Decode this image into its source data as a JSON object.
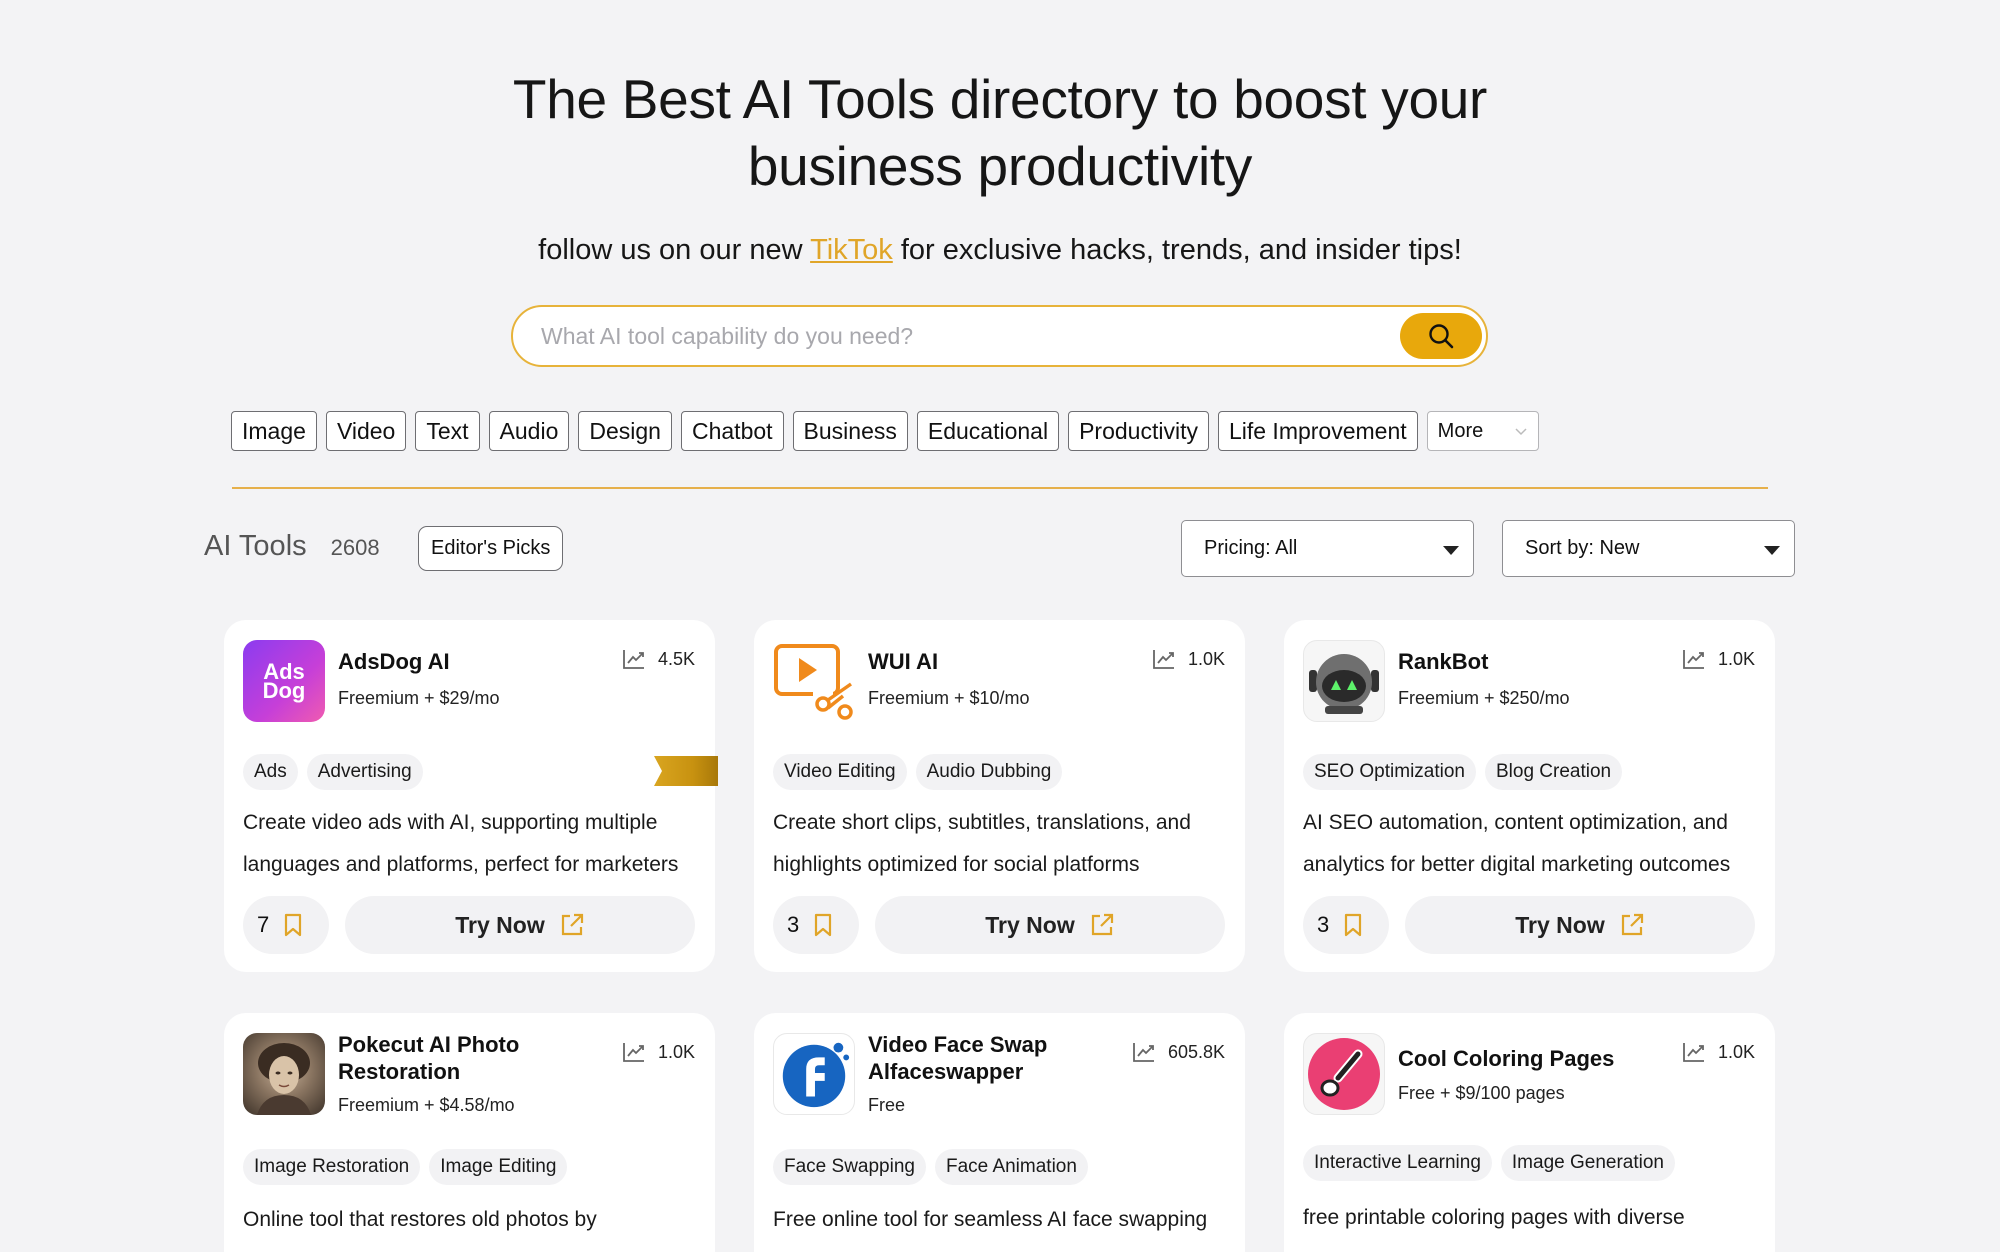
{
  "hero": {
    "title_line1": "The Best AI Tools directory to boost your",
    "title_line2": "business productivity",
    "sub_before": "follow us on our new",
    "sub_link": "TikTok",
    "sub_after": "for exclusive hacks, trends, and insider tips!"
  },
  "search": {
    "placeholder": "What AI tool capability do you need?"
  },
  "categories": [
    "Image",
    "Video",
    "Text",
    "Audio",
    "Design",
    "Chatbot",
    "Business",
    "Educational",
    "Productivity",
    "Life Improvement"
  ],
  "more_label": "More",
  "tools_header": {
    "title": "AI Tools",
    "count": "2608",
    "editors_picks": "Editor's Picks"
  },
  "filters": {
    "pricing": "Pricing: All",
    "sort": "Sort by: New"
  },
  "colors": {
    "accent": "#e8a80c",
    "link": "#e0a528"
  },
  "cards": [
    {
      "name": "AdsDog AI",
      "price": "Freemium + $29/mo",
      "stat": "4.5K",
      "tags": [
        "Ads",
        "Advertising"
      ],
      "desc": "Create video ads with AI, supporting multiple languages and platforms, perfect for marketers",
      "saves": "7",
      "try": "Try Now",
      "logo_text1": "Ads",
      "logo_text2": "Dog"
    },
    {
      "name": "WUI AI",
      "price": "Freemium + $10/mo",
      "stat": "1.0K",
      "tags": [
        "Video Editing",
        "Audio Dubbing"
      ],
      "desc": "Create short clips, subtitles, translations, and highlights optimized for social platforms",
      "saves": "3",
      "try": "Try Now"
    },
    {
      "name": "RankBot",
      "price": "Freemium + $250/mo",
      "stat": "1.0K",
      "tags": [
        "SEO Optimization",
        "Blog Creation"
      ],
      "desc": "AI SEO automation, content optimization, and analytics for better digital marketing outcomes",
      "saves": "3",
      "try": "Try Now"
    },
    {
      "name": "Pokecut AI Photo Restoration",
      "price": "Freemium + $4.58/mo",
      "stat": "1.0K",
      "tags": [
        "Image Restoration",
        "Image Editing"
      ],
      "desc": "Online tool that restores old photos by",
      "saves": "",
      "try": ""
    },
    {
      "name": "Video Face Swap Alfaceswapper",
      "price": "Free",
      "stat": "605.8K",
      "tags": [
        "Face Swapping",
        "Face Animation"
      ],
      "desc": "Free online tool for seamless AI face swapping",
      "saves": "",
      "try": ""
    },
    {
      "name": "Cool Coloring Pages",
      "price": "Free + $9/100 pages",
      "stat": "1.0K",
      "tags": [
        "Interactive Learning",
        "Image Generation"
      ],
      "desc": "free printable coloring pages with diverse",
      "saves": "",
      "try": ""
    }
  ]
}
